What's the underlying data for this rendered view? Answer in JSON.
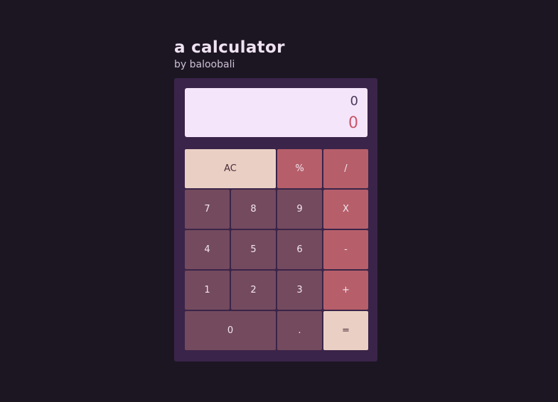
{
  "header": {
    "title": "a calculator",
    "byline": "by baloobali"
  },
  "display": {
    "previous": "0",
    "current": "0"
  },
  "keys": {
    "ac": "AC",
    "percent": "%",
    "divide": "/",
    "seven": "7",
    "eight": "8",
    "nine": "9",
    "multiply": "X",
    "four": "4",
    "five": "5",
    "six": "6",
    "subtract": "-",
    "one": "1",
    "two": "2",
    "three": "3",
    "add": "+",
    "zero": "0",
    "decimal": ".",
    "equals": "="
  },
  "colors": {
    "background": "#1c1623",
    "calculator_body": "#3a2449",
    "display_bg": "#f5e5fb",
    "number_key": "#744a5e",
    "operator_key": "#b65f6a",
    "accent_key": "#ead0c4",
    "current_value_text": "#c9566a"
  }
}
